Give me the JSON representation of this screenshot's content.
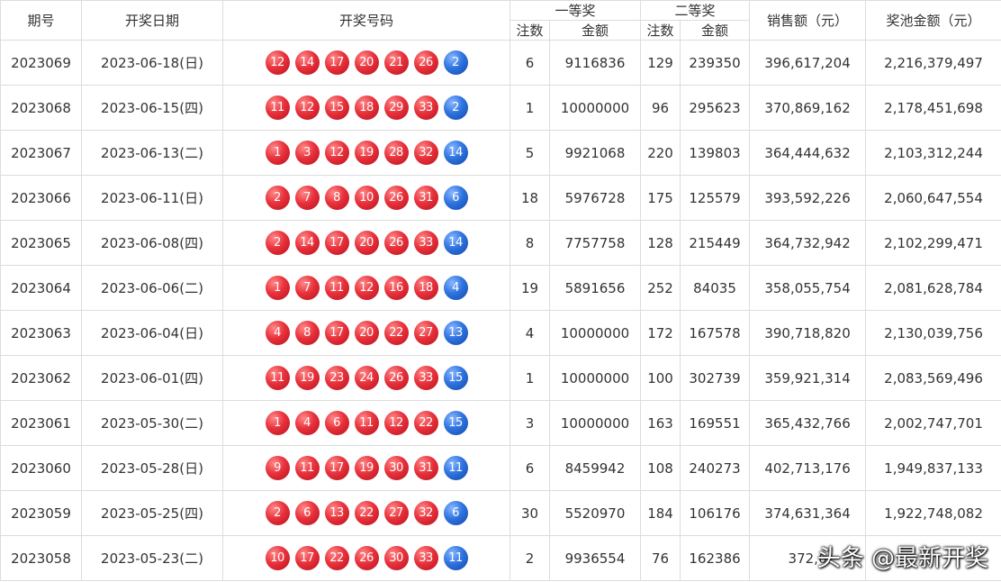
{
  "headers": {
    "issue": "期号",
    "date": "开奖日期",
    "numbers": "开奖号码",
    "first_prize": "一等奖",
    "second_prize": "二等奖",
    "count": "注数",
    "amount": "金额",
    "sales": "销售额（元）",
    "pool": "奖池金额（元）"
  },
  "colors": {
    "red_ball": "#e8323c",
    "blue_ball": "#2f74e0"
  },
  "rows": [
    {
      "issue": "2023069",
      "date": "2023-06-18(日)",
      "reds": [
        "12",
        "14",
        "17",
        "20",
        "21",
        "26"
      ],
      "blue": "2",
      "first_count": "6",
      "first_amount": "9116836",
      "second_count": "129",
      "second_amount": "239350",
      "sales": "396,617,204",
      "pool": "2,216,379,497"
    },
    {
      "issue": "2023068",
      "date": "2023-06-15(四)",
      "reds": [
        "11",
        "12",
        "15",
        "18",
        "29",
        "33"
      ],
      "blue": "2",
      "first_count": "1",
      "first_amount": "10000000",
      "second_count": "96",
      "second_amount": "295623",
      "sales": "370,869,162",
      "pool": "2,178,451,698"
    },
    {
      "issue": "2023067",
      "date": "2023-06-13(二)",
      "reds": [
        "1",
        "3",
        "12",
        "19",
        "28",
        "32"
      ],
      "blue": "14",
      "first_count": "5",
      "first_amount": "9921068",
      "second_count": "220",
      "second_amount": "139803",
      "sales": "364,444,632",
      "pool": "2,103,312,244"
    },
    {
      "issue": "2023066",
      "date": "2023-06-11(日)",
      "reds": [
        "2",
        "7",
        "8",
        "10",
        "26",
        "31"
      ],
      "blue": "6",
      "first_count": "18",
      "first_amount": "5976728",
      "second_count": "175",
      "second_amount": "125579",
      "sales": "393,592,226",
      "pool": "2,060,647,554"
    },
    {
      "issue": "2023065",
      "date": "2023-06-08(四)",
      "reds": [
        "2",
        "14",
        "17",
        "20",
        "26",
        "33"
      ],
      "blue": "14",
      "first_count": "8",
      "first_amount": "7757758",
      "second_count": "128",
      "second_amount": "215449",
      "sales": "364,732,942",
      "pool": "2,102,299,471"
    },
    {
      "issue": "2023064",
      "date": "2023-06-06(二)",
      "reds": [
        "1",
        "7",
        "11",
        "12",
        "16",
        "18"
      ],
      "blue": "4",
      "first_count": "19",
      "first_amount": "5891656",
      "second_count": "252",
      "second_amount": "84035",
      "sales": "358,055,754",
      "pool": "2,081,628,784"
    },
    {
      "issue": "2023063",
      "date": "2023-06-04(日)",
      "reds": [
        "4",
        "8",
        "17",
        "20",
        "22",
        "27"
      ],
      "blue": "13",
      "first_count": "4",
      "first_amount": "10000000",
      "second_count": "172",
      "second_amount": "167578",
      "sales": "390,718,820",
      "pool": "2,130,039,756"
    },
    {
      "issue": "2023062",
      "date": "2023-06-01(四)",
      "reds": [
        "11",
        "19",
        "23",
        "24",
        "26",
        "33"
      ],
      "blue": "15",
      "first_count": "1",
      "first_amount": "10000000",
      "second_count": "100",
      "second_amount": "302739",
      "sales": "359,921,314",
      "pool": "2,083,569,496"
    },
    {
      "issue": "2023061",
      "date": "2023-05-30(二)",
      "reds": [
        "1",
        "4",
        "6",
        "11",
        "12",
        "22"
      ],
      "blue": "15",
      "first_count": "3",
      "first_amount": "10000000",
      "second_count": "163",
      "second_amount": "169551",
      "sales": "365,432,766",
      "pool": "2,002,747,701"
    },
    {
      "issue": "2023060",
      "date": "2023-05-28(日)",
      "reds": [
        "9",
        "11",
        "17",
        "19",
        "30",
        "31"
      ],
      "blue": "11",
      "first_count": "6",
      "first_amount": "8459942",
      "second_count": "108",
      "second_amount": "240273",
      "sales": "402,713,176",
      "pool": "1,949,837,133"
    },
    {
      "issue": "2023059",
      "date": "2023-05-25(四)",
      "reds": [
        "2",
        "6",
        "13",
        "22",
        "27",
        "32"
      ],
      "blue": "6",
      "first_count": "30",
      "first_amount": "5520970",
      "second_count": "184",
      "second_amount": "106176",
      "sales": "374,631,364",
      "pool": "1,922,748,082"
    },
    {
      "issue": "2023058",
      "date": "2023-05-23(二)",
      "reds": [
        "10",
        "17",
        "22",
        "26",
        "30",
        "33"
      ],
      "blue": "11",
      "first_count": "2",
      "first_amount": "9936554",
      "second_count": "76",
      "second_amount": "162386",
      "sales": "372,6",
      "pool": ""
    }
  ],
  "watermark": "头条 @最新开奖"
}
